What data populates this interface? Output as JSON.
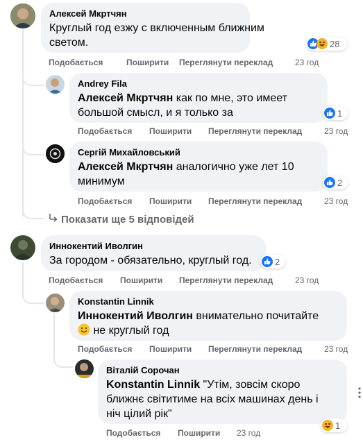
{
  "actions": {
    "like": "Подобається",
    "reply": "Поширити",
    "translate": "Переглянути переклад"
  },
  "comments": [
    {
      "author": "Алексей Мкртчян",
      "text_line1": "Круглый год езжу с включенным ближним",
      "text_line2": "светом.",
      "time": "23 год",
      "reaction_count": "28",
      "reaction_icons": [
        "like-icon",
        "haha-icon"
      ]
    },
    {
      "author": "Andrey Fila",
      "mention": "Алексей Мкртчян",
      "text_line1_rest": " как по мне, это имеет",
      "text_line2": "большой смысл, и я только за",
      "time": "23 год",
      "reaction_count": "1"
    },
    {
      "author": "Сергій Михайловський",
      "mention": "Алексей Мкртчян",
      "text_line1_rest": " аналогично уже лет 10",
      "text_line2": "минимум",
      "time": "23 год",
      "reaction_count": "2"
    },
    {
      "author": "Иннокентий Иволгин",
      "text_line1": "За городом - обязательно, круглый год.",
      "time": "23 год",
      "reaction_count": "2"
    },
    {
      "author": "Konstantin Linnik",
      "mention": "Иннокентий Иволгин",
      "text_line1_rest": " внимательно почитайте",
      "text_line2_rest": " не круглый год",
      "time": "23 год"
    },
    {
      "author": "Віталій Сорочан",
      "mention": "Konstantin Linnik",
      "text_line1_rest": " \"Утім, зовсім скоро",
      "text_line2": "ближнє світитиме на всіх машинах день і",
      "text_line3": "ніч цілий рік\"",
      "time": "23 год",
      "reaction_count": "1"
    }
  ],
  "show_more": "Показати ще 5 відповідей",
  "colors": {
    "bubble": "#f0f2f5",
    "secondary_text": "#65676b",
    "like_blue": "#1877f2",
    "thread_line": "#e4e6eb"
  }
}
